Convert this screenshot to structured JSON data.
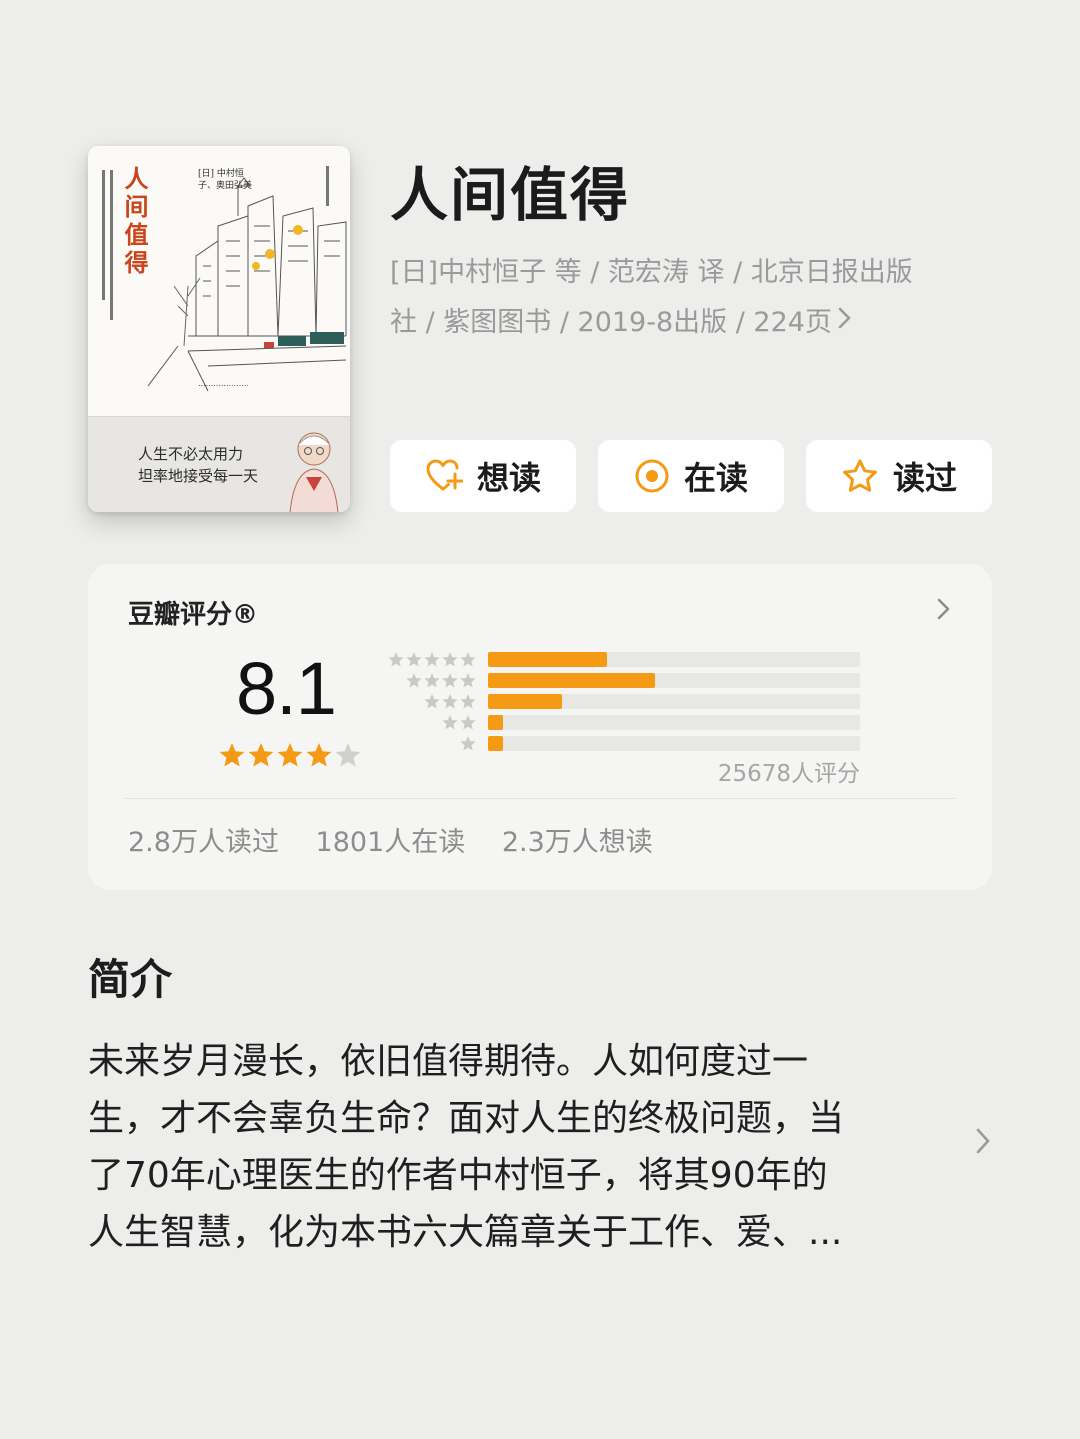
{
  "book": {
    "title": "人间值得",
    "meta_line1": "[日]中村恒子 等 / 范宏涛 译 / 北京日报出版",
    "meta_line2": "社 / 紫图图书 / 2019-8出版 / 224页",
    "cover": {
      "title": "人间值得",
      "author": "[日] 中村恒子、奥田弘美",
      "band_line1": "人生不必太用力",
      "band_line2": "坦率地接受每一天"
    }
  },
  "actions": {
    "want": {
      "label": "想读",
      "icon": "heart-plus-icon"
    },
    "reading": {
      "label": "在读",
      "icon": "target-circle-icon"
    },
    "read": {
      "label": "读过",
      "icon": "star-outline-icon"
    }
  },
  "rating": {
    "label": "豆瓣评分®",
    "score": "8.1",
    "stars_filled": 4,
    "stars_total": 5,
    "distribution": [
      {
        "stars": 5,
        "fraction": 0.32
      },
      {
        "stars": 4,
        "fraction": 0.45
      },
      {
        "stars": 3,
        "fraction": 0.2
      },
      {
        "stars": 2,
        "fraction": 0.04
      },
      {
        "stars": 1,
        "fraction": 0.04
      }
    ],
    "vote_count": "25678人评分",
    "stats": [
      "2.8万人读过",
      "1801人在读",
      "2.3万人想读"
    ],
    "star_color": "#f49a14",
    "star_empty_color": "#d0d0cd"
  },
  "intro": {
    "title": "简介",
    "line1": "未来岁月漫长，依旧值得期待。人如何度过一",
    "line2": "生，才不会辜负生命？面对人生的终极问题，当",
    "line3": "了70年心理医生的作者中村恒子，将其90年的",
    "line4": "人生智慧，化为本书六大篇章关于工作、爱、..."
  }
}
